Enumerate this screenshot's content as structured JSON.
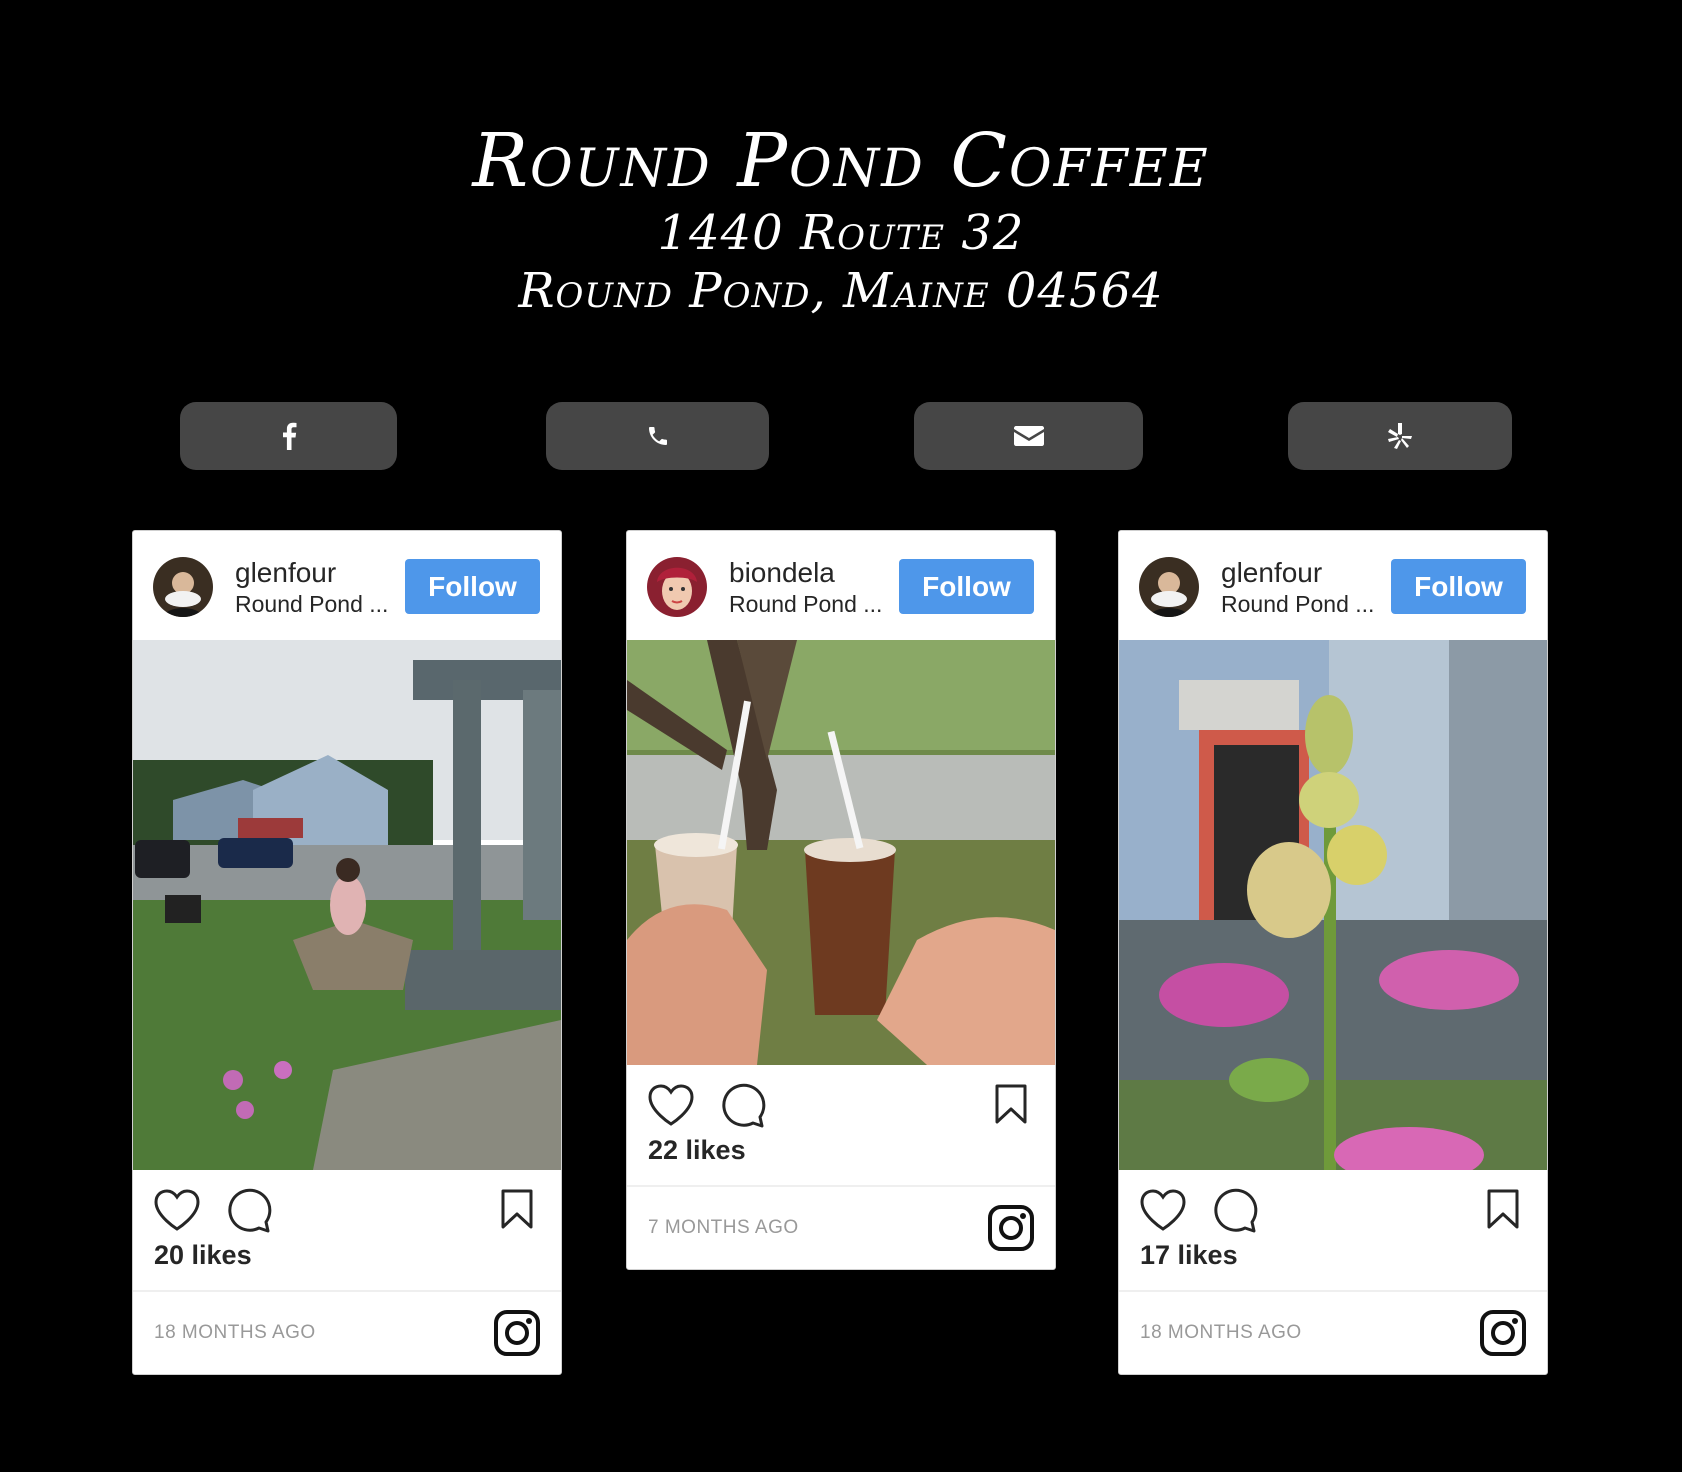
{
  "header": {
    "title": "Round Pond Coffee",
    "address_line1": "1440 Route 32",
    "address_line2": "Round Pond, Maine 04564"
  },
  "social": [
    {
      "icon": "facebook-icon"
    },
    {
      "icon": "phone-icon"
    },
    {
      "icon": "envelope-icon"
    },
    {
      "icon": "yelp-icon"
    }
  ],
  "posts": [
    {
      "username": "glenfour",
      "location": "Round Pond ...",
      "follow_label": "Follow",
      "likes": "20 likes",
      "time_ago": "18 MONTHS AGO",
      "photo": "porch-street-scene"
    },
    {
      "username": "biondela",
      "location": "Round Pond ...",
      "follow_label": "Follow",
      "likes": "22 likes",
      "time_ago": "7 MONTHS AGO",
      "photo": "iced-coffee-cheers"
    },
    {
      "username": "glenfour",
      "location": "Round Pond ...",
      "follow_label": "Follow",
      "likes": "17 likes",
      "time_ago": "18 MONTHS AGO",
      "photo": "foxglove-flower"
    }
  ],
  "colors": {
    "background": "#000000",
    "social_button": "#464646",
    "follow_button": "#4e97ea"
  }
}
